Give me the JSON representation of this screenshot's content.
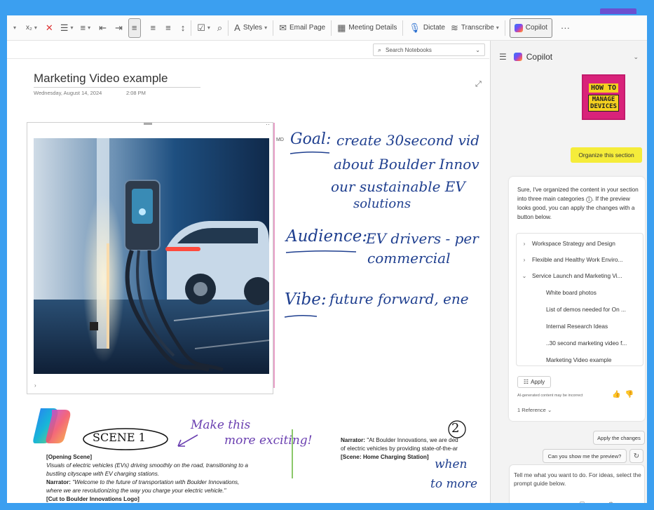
{
  "ribbon": {
    "subscript_label": "x₂",
    "styles_label": "Styles",
    "email_page_label": "Email Page",
    "meeting_details_label": "Meeting Details",
    "dictate_label": "Dictate",
    "transcribe_label": "Transcribe",
    "copilot_label": "Copilot",
    "more_label": "···"
  },
  "search": {
    "placeholder": "Search Notebooks"
  },
  "page": {
    "title": "Marketing Video example",
    "date": "Wednesday, August 14, 2024",
    "time": "2:08 PM",
    "md_label": "MD"
  },
  "handwriting": {
    "goal_label": "Goal:",
    "goal_line1": "create 30second vid",
    "goal_line2": "about Boulder Innov",
    "goal_line3": "our sustainable EV",
    "goal_line4": "solutions",
    "audience_label": "Audience:",
    "audience_line1": "EV drivers - per",
    "audience_line2": "commercial",
    "vibe_label": "Vibe:",
    "vibe_text": "future forward, ene",
    "scene_label": "SCENE 1",
    "make_line1": "Make this",
    "make_line2": "more exciting!",
    "number_two": "2",
    "when_line1": "when",
    "when_line2": "to more"
  },
  "script_left": {
    "heading": "[Opening Scene]",
    "visual_line1": "Visuals of electric vehicles (EVs) driving smoothly on the road, transitioning to a",
    "visual_line2": "bustling cityscape with EV charging stations.",
    "narrator_label": "Narrator:",
    "narrator_line1": "\"Welcome to the future of transportation with Boulder Innovations,",
    "narrator_line2": "where we are revolutionizing the way you charge your electric vehicle.\"",
    "cut": "[Cut to Boulder Innovations Logo]"
  },
  "script_right": {
    "narrator_label": "Narrator:",
    "line1": "\"At Boulder Innovations, we are ded",
    "line2": "of electric vehicles by providing state-of-the-ar",
    "scene": "[Scene: Home Charging Station]"
  },
  "copilot_pane": {
    "title": "Copilot",
    "logo_line1": "HOW TO",
    "logo_line2": "MANAGE",
    "logo_line3": "DEVICES",
    "user_message": "Organize this section",
    "response_part1": "Sure, I've organized the content in your section into three main categories",
    "citation": "1",
    "response_part2": ". If the preview looks good, you can apply the changes with a button below.",
    "tree": [
      {
        "label": "Workspace Strategy and Design",
        "arrow": "›"
      },
      {
        "label": "Flexible and Healthy Work Enviro...",
        "arrow": "›"
      },
      {
        "label": "Service Launch and Marketing Vi...",
        "arrow": "⌄"
      }
    ],
    "tree_children": [
      "White board photos",
      "List of demos needed for On ...",
      "Internal Research Ideas",
      "..30 second marketing video f...",
      "Marketing Video example"
    ],
    "apply_label": "Apply",
    "disclaimer": "AI-generated content may be incorrect",
    "reference_label": "1 Reference",
    "suggestion_apply": "Apply the changes",
    "suggestion_preview": "Can you show me the preview?",
    "prompt_placeholder": "Tell me what you want to do. For ideas, select the prompt guide below."
  },
  "colors": {
    "frame_border": "#3b9ff0",
    "highlight_yellow": "#f5ec3a",
    "ink_blue": "#1f3f8f",
    "ink_purple": "#6a3fb0",
    "brand_pink": "#d9227a"
  }
}
